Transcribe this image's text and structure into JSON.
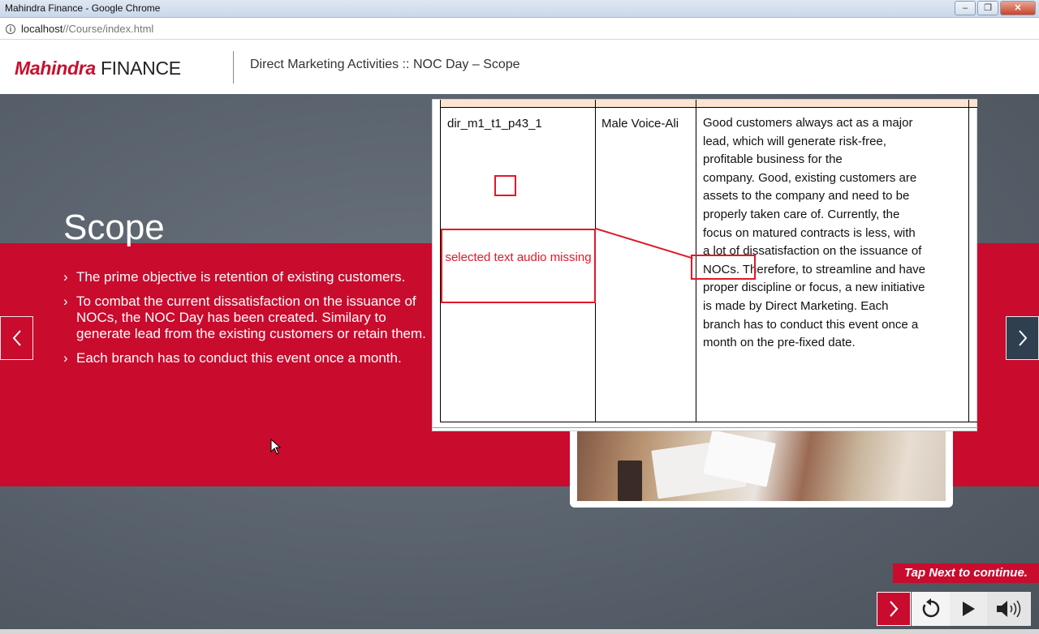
{
  "browser": {
    "window_title": "Mahindra Finance - Google Chrome",
    "url_host": "localhost",
    "url_path": "//Course/index.html",
    "minimize_label": "–",
    "maximize_label": "❐",
    "close_label": "✕"
  },
  "header": {
    "logo_brand": "Mahindra",
    "logo_suffix": "FINANCE",
    "title": "Direct Marketing Activities :: NOC Day – Scope"
  },
  "slide": {
    "heading": "Scope",
    "bullets": [
      "The prime objective is retention of existing customers.",
      "To combat the current dissatisfaction on the issuance of NOCs, the NOC Day has been created. Similary to generate lead from the existing customers or retain them.",
      "Each branch has to conduct this event once a month."
    ]
  },
  "doc_overlay": {
    "row_id": "dir_m1_t1_p43_1",
    "voice": "Male Voice-Ali",
    "script_lines": [
      "Good customers always act as a major",
      "lead, which will generate risk-free,",
      "profitable business for the",
      "company. Good, existing customers are",
      "assets to the company and need to be",
      "properly taken care of. Currently, the",
      "focus on matured contracts is less, with",
      "a lot of dissatisfaction on the issuance of",
      "NOCs. Therefore, to streamline and have",
      "proper discipline or focus, a new initiative",
      "is made by Direct Marketing. Each",
      "branch has to conduct this event once a",
      "month on the pre-fixed date."
    ],
    "annotation": "selected text audio missing",
    "annotation_color": "#e0192a"
  },
  "controls": {
    "tap_next": "Tap Next to continue.",
    "accent": "#c90b2d",
    "next_icon": "chevron-right-icon",
    "replay_icon": "replay-icon",
    "play_icon": "play-icon",
    "audio_icon": "speaker-icon"
  }
}
